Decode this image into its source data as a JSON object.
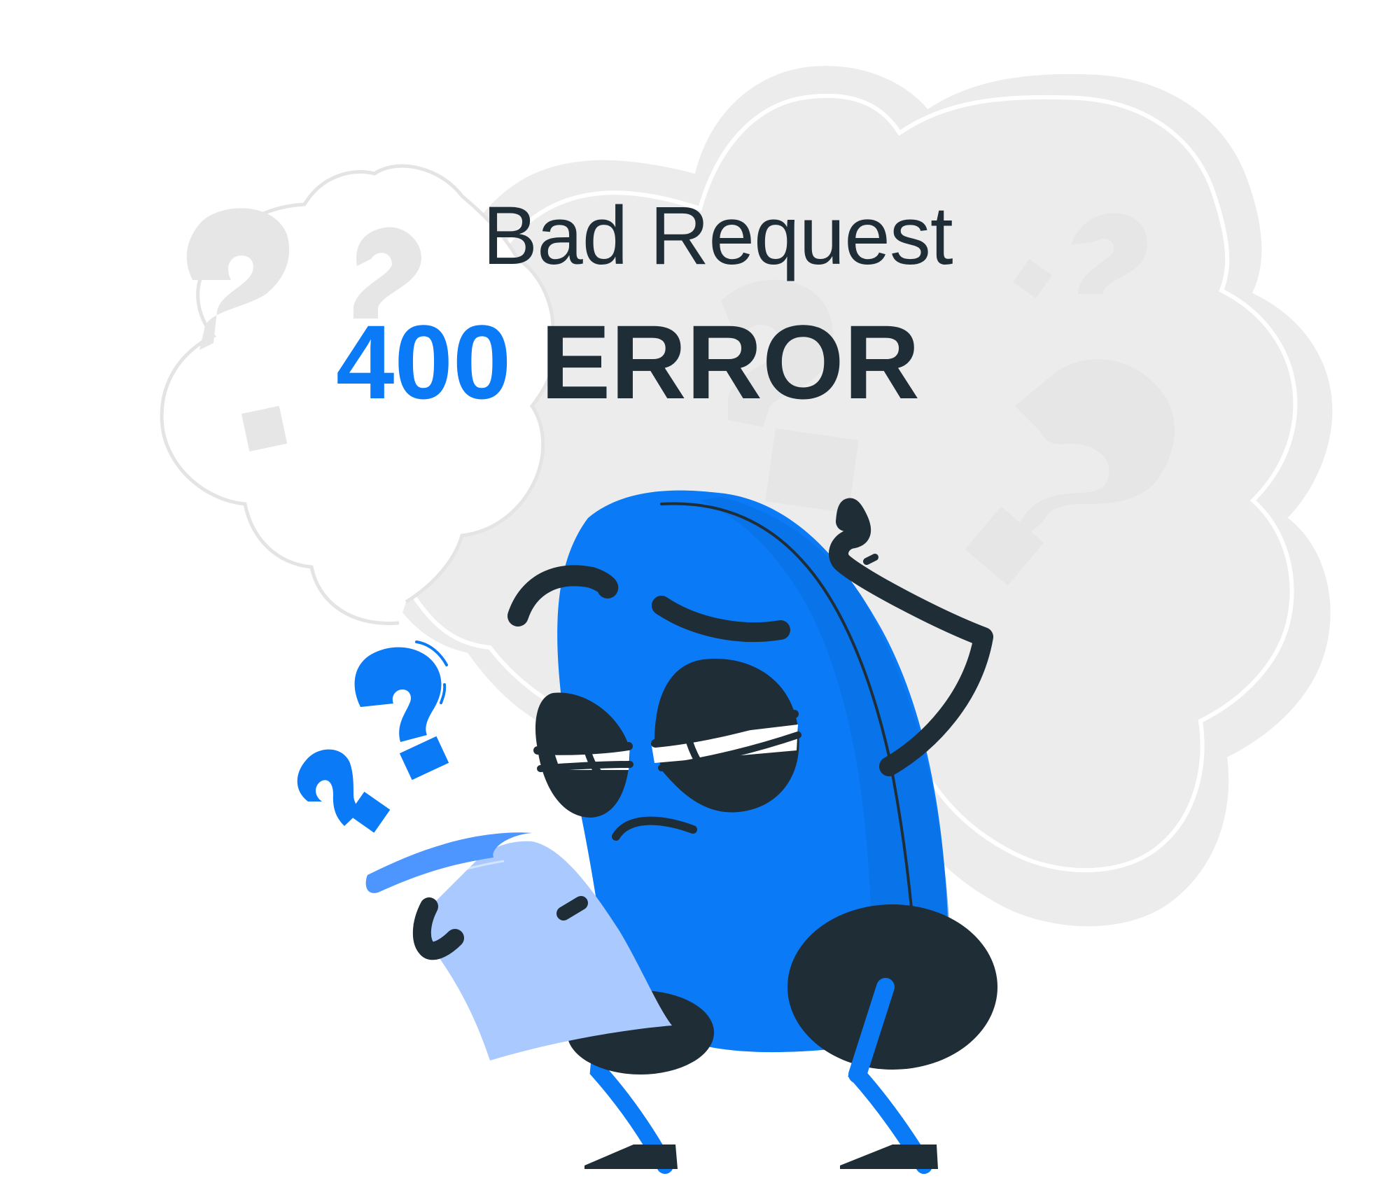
{
  "heading": {
    "subtitle": "Bad Request",
    "code": "400",
    "word": "ERROR"
  },
  "colors": {
    "accent": "#0a7af6",
    "dark": "#1f2d36",
    "cloud": "#ececec",
    "paper": "#a9c9ff",
    "paper_fold": "#4d96ff"
  },
  "illustration": {
    "character": "blue bean character scratching head while reading a paper",
    "icons": [
      "question-mark-icon",
      "thought-cloud-icon",
      "paper-icon"
    ]
  }
}
